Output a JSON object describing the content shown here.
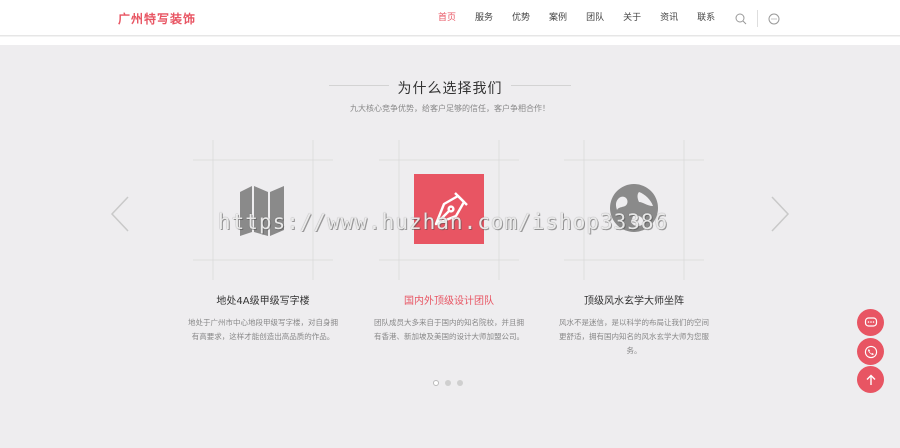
{
  "header": {
    "logo": "广州特写装饰",
    "nav": [
      "首页",
      "服务",
      "优势",
      "案例",
      "团队",
      "关于",
      "资讯",
      "联系"
    ],
    "active_index": 0
  },
  "section": {
    "title": "为什么选择我们",
    "subtitle": "九大核心竞争优势，给客户足够的信任，客户争相合作！"
  },
  "cards": [
    {
      "icon": "map-icon",
      "title": "地处4A级甲级写字楼",
      "desc": "地处于广州市中心地段甲级写字楼，对自身拥有高要求，这样才能创造出高品质的作品。"
    },
    {
      "icon": "pen-nib-icon",
      "title": "国内外顶级设计团队",
      "desc": "团队成员大多来自于国内的知名院校，并且拥有香港、新加坡及美国的设计大师加盟公司。"
    },
    {
      "icon": "globe-icon",
      "title": "顶级风水玄学大师坐阵",
      "desc": "风水不是迷信，是以科学的布局让我们的空间更舒适，拥有国内知名的风水玄学大师为您服务。"
    }
  ],
  "carousel": {
    "dot_count": 3,
    "active_dot": 0
  },
  "watermark": "https://www.huzhan.com/ishop33386",
  "colors": {
    "accent": "#e85563",
    "bg": "#eeedef"
  }
}
